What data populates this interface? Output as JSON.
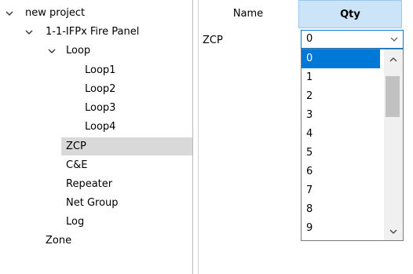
{
  "tree": {
    "root": "new project",
    "panel": "1-1-IFPx Fire Panel",
    "loop": "Loop",
    "loops": [
      "Loop1",
      "Loop2",
      "Loop3",
      "Loop4"
    ],
    "items": [
      "ZCP",
      "C&E",
      "Repeater",
      "Net Group",
      "Log"
    ],
    "zone": "Zone",
    "selected": "ZCP"
  },
  "grid": {
    "columns": [
      "Name",
      "Qty"
    ],
    "row": {
      "name": "ZCP",
      "qty": "0"
    }
  },
  "dropdown": {
    "options": [
      "0",
      "1",
      "2",
      "3",
      "4",
      "5",
      "6",
      "7",
      "8",
      "9"
    ],
    "selected": "0"
  },
  "icons": {
    "expand": "chevron-down-icon",
    "combo_arrow": "chevron-down-icon",
    "scroll_up": "chevron-up-icon",
    "scroll_down": "chevron-down-icon"
  },
  "colors": {
    "tree_selection": "#d9d9d9",
    "header_active": "#cce4f7",
    "option_highlight": "#0078d7"
  }
}
